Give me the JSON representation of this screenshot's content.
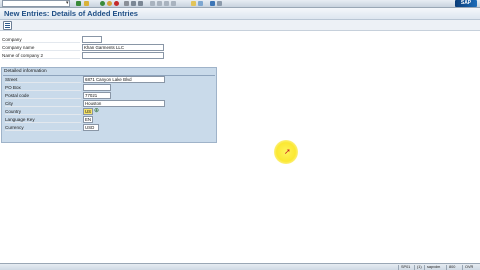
{
  "toolbar": {
    "command_field_value": "",
    "icons": [
      "enter-icon",
      "save-icon",
      "back-icon",
      "exit-icon",
      "cancel-icon",
      "print-icon",
      "find-icon",
      "find-next-icon",
      "first-page-icon",
      "prev-page-icon",
      "next-page-icon",
      "last-page-icon",
      "new-session-icon",
      "shortcut-icon",
      "help-icon",
      "layout-menu-icon"
    ],
    "logo_text": "SAP"
  },
  "title": "New Entries: Details of Added Entries",
  "form": {
    "company": {
      "label": "Company",
      "value": ""
    },
    "company_name": {
      "label": "Company name",
      "value": "Khan Garments LLC"
    },
    "company_name2": {
      "label": "Name of company 2",
      "value": ""
    }
  },
  "detailed_info": {
    "title": "Detailed information",
    "street": {
      "label": "Street",
      "value": "6871 Canyon Lake Blvd"
    },
    "po_box": {
      "label": "PO Box",
      "value": ""
    },
    "postal_code": {
      "label": "Postal code",
      "value": "77021"
    },
    "city": {
      "label": "City",
      "value": "Houston"
    },
    "country": {
      "label": "Country",
      "value": "US"
    },
    "language_key": {
      "label": "Language Key",
      "value": "EN"
    },
    "currency": {
      "label": "Currency",
      "value": "USD"
    }
  },
  "statusbar": {
    "system": "SP01",
    "client": "(1)",
    "user": "800",
    "server": "sapvdm",
    "mode": "OVR"
  },
  "colors": {
    "title": "#1f4f86",
    "group_bg": "#c9daea",
    "cursor_highlight": "#fbe832"
  }
}
